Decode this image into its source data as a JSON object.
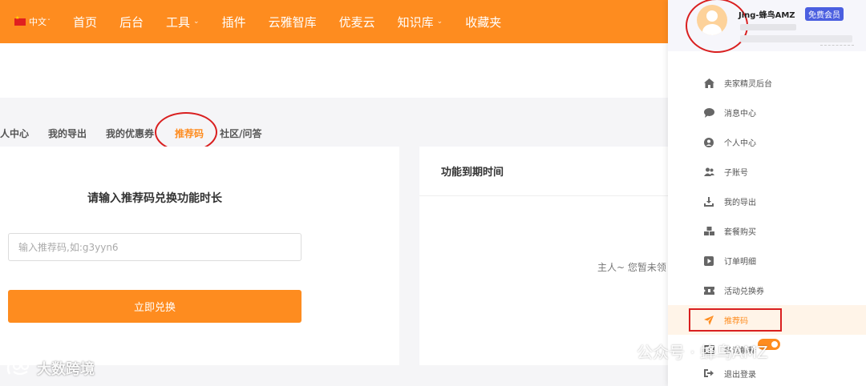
{
  "nav": {
    "lang": "中文",
    "items": [
      {
        "label": "首页"
      },
      {
        "label": "后台"
      },
      {
        "label": "工具",
        "chevron": true
      },
      {
        "label": "插件"
      },
      {
        "label": "云雅智库"
      },
      {
        "label": "优麦云"
      },
      {
        "label": "知识库",
        "chevron": true
      },
      {
        "label": "收藏夹"
      }
    ]
  },
  "tabs": [
    "人中心",
    "我的导出",
    "我的优惠券",
    "推荐码",
    "社区/问答"
  ],
  "redeem": {
    "title": "请输入推荐码兑换功能时长",
    "placeholder": "输入推荐码,如:g3yyn6",
    "button": "立即兑换"
  },
  "expiry": {
    "title": "功能到期时间",
    "empty_text": "主人~ 您暂未领"
  },
  "user": {
    "name": "Jing-蜂鸟AMZ",
    "badge": "免费会员"
  },
  "menu": [
    {
      "label": "卖家精灵后台",
      "icon": "home-icon"
    },
    {
      "label": "消息中心",
      "icon": "chat-bubble-icon"
    },
    {
      "label": "个人中心",
      "icon": "user-circle-icon"
    },
    {
      "label": "子账号",
      "icon": "users-icon"
    },
    {
      "label": "我的导出",
      "icon": "download-icon"
    },
    {
      "label": "套餐购买",
      "icon": "cubes-icon"
    },
    {
      "label": "订单明细",
      "icon": "play-box-icon"
    },
    {
      "label": "活动兑换券",
      "icon": "ticket-icon"
    },
    {
      "label": "推荐码",
      "icon": "paper-plane-icon",
      "active": true
    },
    {
      "label": "名词解释",
      "icon": "book-icon"
    },
    {
      "label": "退出登录",
      "icon": "logout-icon"
    }
  ],
  "watermarks": {
    "left": "大数跨境",
    "right": "公众号 · 蜂鸟AMZ"
  },
  "colors": {
    "brand_orange": "#fe8c1f",
    "badge_blue": "#4b5fe0",
    "annotation_red": "#d91f1f"
  }
}
